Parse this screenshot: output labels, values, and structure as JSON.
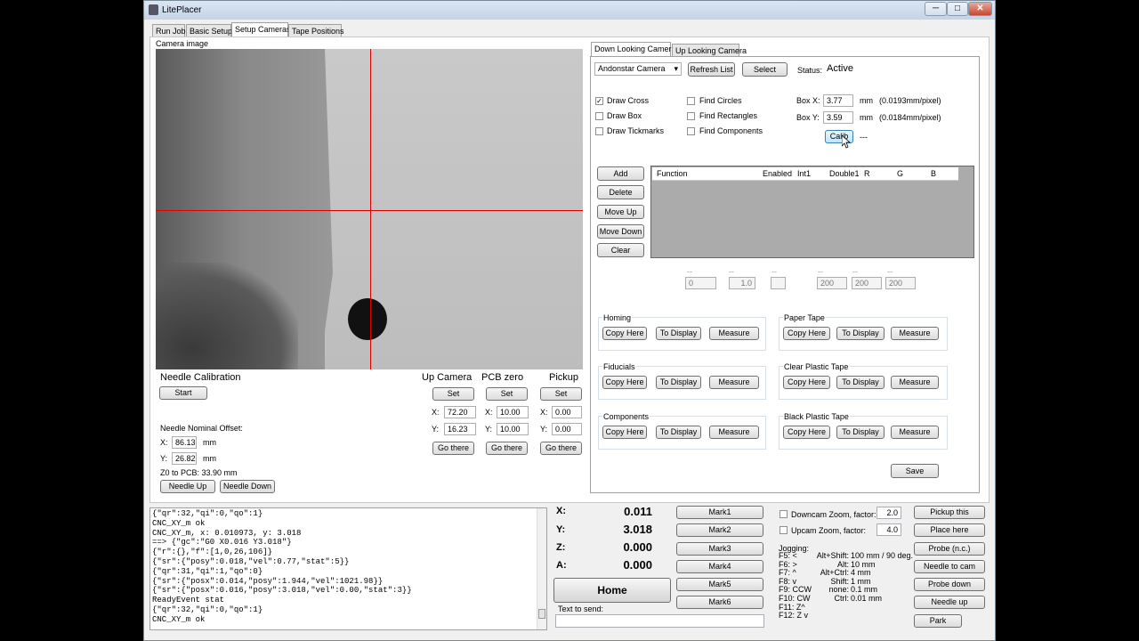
{
  "window": {
    "title": "LitePlacer",
    "min": "─",
    "max": "□",
    "close": "✕"
  },
  "main_tabs": [
    "Run Job",
    "Basic Setup",
    "Setup Cameras",
    "Tape Positions"
  ],
  "camera": {
    "label": "Camera image"
  },
  "needle_cal": {
    "title": "Needle Calibration",
    "start": "Start",
    "offset_label": "Needle Nominal Offset:",
    "x_label": "X:",
    "x_value": "86.13",
    "x_unit": "mm",
    "y_label": "Y:",
    "y_value": "26.82",
    "y_unit": "mm",
    "z0_text": "Z0 to PCB:   33.90 mm",
    "needle_up": "Needle Up",
    "needle_down": "Needle Down"
  },
  "quick_pos": [
    {
      "title": "Up Camera",
      "set": "Set",
      "x": "72.20",
      "y": "16.23",
      "go": "Go there"
    },
    {
      "title": "PCB zero",
      "set": "Set",
      "x": "10.00",
      "y": "10.00",
      "go": "Go there"
    },
    {
      "title": "Pickup",
      "set": "Set",
      "x": "0.00",
      "y": "0.00",
      "go": "Go there"
    }
  ],
  "axis_labels": {
    "x": "X:",
    "y": "Y:"
  },
  "cam_tabs": [
    "Down Looking Camera",
    "Up Looking Camera"
  ],
  "cam_select": {
    "value": "Andonstar Camera",
    "refresh": "Refresh List",
    "select": "Select",
    "status_label": "Status:",
    "status_value": "Active"
  },
  "draw_opts": [
    {
      "label": "Draw Cross",
      "checked": "✓"
    },
    {
      "label": "Draw Box",
      "checked": ""
    },
    {
      "label": "Draw Tickmarks",
      "checked": ""
    }
  ],
  "find_opts": [
    "Find Circles",
    "Find Rectangles",
    "Find Components"
  ],
  "box": {
    "x_label": "Box X:",
    "x_value": "3.77",
    "x_unit": "mm",
    "x_scale": "(0.0193mm/pixel)",
    "y_label": "Box Y:",
    "y_value": "3.59",
    "y_unit": "mm",
    "y_scale": "(0.0184mm/pixel)",
    "calib": "Calib",
    "calib_status": "---"
  },
  "func_buttons": [
    "Add",
    "Delete",
    "Move Up",
    "Move Down",
    "Clear"
  ],
  "func_table": {
    "headers": [
      "Function",
      "Enabled",
      "Int1",
      "Double1",
      "R",
      "G",
      "B"
    ]
  },
  "param_row": {
    "dashes": "--",
    "v1": "0",
    "v2": "1.0",
    "v3": "200",
    "v4": "200",
    "v5": "200"
  },
  "groups": [
    {
      "title": "Homing",
      "b1": "Copy Here",
      "b2": "To Display",
      "b3": "Measure"
    },
    {
      "title": "Paper Tape",
      "b1": "Copy Here",
      "b2": "To Display",
      "b3": "Measure"
    },
    {
      "title": "Fiducials",
      "b1": "Copy Here",
      "b2": "To Display",
      "b3": "Measure"
    },
    {
      "title": "Clear Plastic Tape",
      "b1": "Copy Here",
      "b2": "To Display",
      "b3": "Measure"
    },
    {
      "title": "Components",
      "b1": "Copy Here",
      "b2": "To Display",
      "b3": "Measure"
    },
    {
      "title": "Black Plastic Tape",
      "b1": "Copy Here",
      "b2": "To Display",
      "b3": "Measure"
    }
  ],
  "save": "Save",
  "console_lines": [
    "{\"qr\":32,\"qi\":0,\"qo\":1}",
    "CNC_XY_m ok",
    "CNC_XY_m, x: 0.010973, y: 3.018",
    "==> {\"gc\":\"G0 X0.016 Y3.018\"}",
    "{\"r\":{},\"f\":[1,0,26,106]}",
    "{\"sr\":{\"posy\":0.018,\"vel\":0.77,\"stat\":5}}",
    "{\"qr\":31,\"qi\":1,\"qo\":0}",
    "{\"sr\":{\"posx\":0.014,\"posy\":1.944,\"vel\":1021.98}}",
    "{\"sr\":{\"posx\":0.016,\"posy\":3.018,\"vel\":0.00,\"stat\":3}}",
    "ReadyEvent stat",
    "{\"qr\":32,\"qi\":0,\"qo\":1}",
    "CNC_XY_m ok"
  ],
  "position": [
    {
      "label": "X:",
      "value": "0.011"
    },
    {
      "label": "Y:",
      "value": "3.018"
    },
    {
      "label": "Z:",
      "value": "0.000"
    },
    {
      "label": "A:",
      "value": "0.000"
    }
  ],
  "home": "Home",
  "text_to_send_label": "Text to send:",
  "marks": [
    "Mark1",
    "Mark2",
    "Mark3",
    "Mark4",
    "Mark5",
    "Mark6"
  ],
  "zoom": {
    "down_label": "Downcam Zoom, factor:",
    "down_value": "2.0",
    "up_label": "Upcam Zoom, factor:",
    "up_value": "4.0"
  },
  "jogging": {
    "title": "Jogging:",
    "keys": [
      "F5: <",
      "F6: >",
      "F7: ^",
      "F8: v",
      "F9: CCW",
      "F10: CW",
      "F11: Z^",
      "F12: Z v"
    ],
    "mods": [
      {
        "mod": "Alt+Shift:",
        "val": "100 mm / 90 deg."
      },
      {
        "mod": "Alt:",
        "val": "10 mm"
      },
      {
        "mod": "Alt+Ctrl:",
        "val": "4 mm"
      },
      {
        "mod": "Shift:",
        "val": "1 mm"
      },
      {
        "mod": "none:",
        "val": "0.1 mm"
      },
      {
        "mod": "Ctrl:",
        "val": "0.01 mm"
      }
    ]
  },
  "right_buttons": [
    "Pickup this",
    "Place here",
    "Probe (n.c.)",
    "Needle to cam",
    "Probe down",
    "Needle up",
    "Park"
  ]
}
